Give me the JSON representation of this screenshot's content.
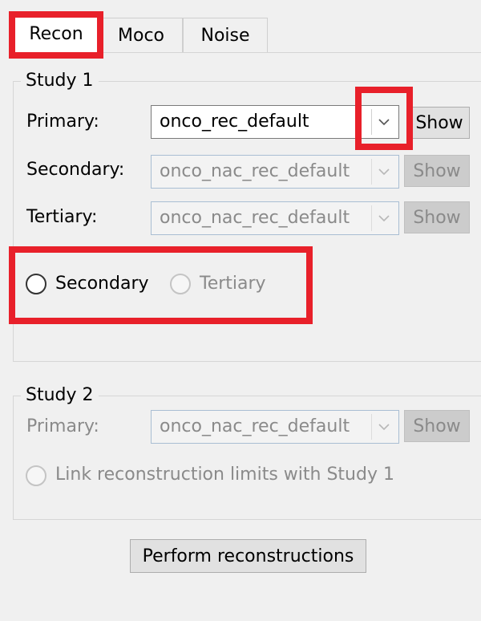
{
  "tabs": [
    {
      "label": "Recon",
      "active": true
    },
    {
      "label": "Moco",
      "active": false
    },
    {
      "label": "Noise",
      "active": false
    }
  ],
  "study1": {
    "title": "Study 1",
    "primary": {
      "label": "Primary:",
      "value": "onco_rec_default",
      "show": "Show",
      "enabled": true
    },
    "secondary": {
      "label": "Secondary:",
      "value": "onco_nac_rec_default",
      "show": "Show",
      "enabled": false
    },
    "tertiary": {
      "label": "Tertiary:",
      "value": "onco_nac_rec_default",
      "show": "Show",
      "enabled": false
    },
    "radios": [
      {
        "label": "Secondary",
        "enabled": true,
        "checked": false
      },
      {
        "label": "Tertiary",
        "enabled": false,
        "checked": false
      }
    ]
  },
  "study2": {
    "title": "Study 2",
    "primary": {
      "label": "Primary:",
      "value": "onco_nac_rec_default",
      "show": "Show",
      "enabled": false
    },
    "link_label": "Link reconstruction limits with Study 1"
  },
  "perform_button": "Perform reconstructions",
  "highlight_color": "#e8202a"
}
